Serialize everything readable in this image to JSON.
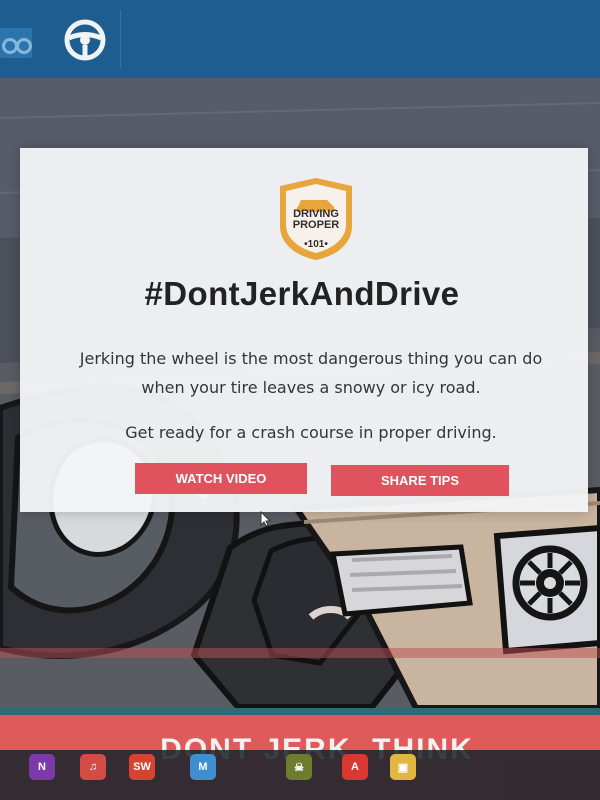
{
  "topbar": {
    "brand_icon": "car-driving-icon",
    "wheel_icon": "steering-wheel-icon"
  },
  "logo": {
    "text": "DRIVING PROPER",
    "number": "•101•"
  },
  "headline": "#DontJerkAndDrive",
  "body_text": "Jerking the wheel is the most dangerous thing you can do when your tire leaves a snowy or icy road.",
  "subtext": "Get ready for a crash course in proper driving.",
  "buttons": {
    "watch_video": "WATCH VIDEO",
    "share_tips": "SHARE TIPS"
  },
  "banner_text": "DONT JERK. THINK",
  "taskbar": [
    {
      "label": "N",
      "icon": "onenote-icon",
      "color": "#7b3aa8"
    },
    {
      "label": "♫",
      "icon": "music-icon",
      "color": "#d44b46"
    },
    {
      "label": "SW",
      "icon": "solidworks-icon",
      "color": "#d7432f"
    },
    {
      "label": "M",
      "icon": "app-icon",
      "color": "#3e8ed0"
    },
    {
      "label": "☠",
      "icon": "game-icon",
      "color": "#6d7c2d"
    },
    {
      "label": "A",
      "icon": "adobe-acrobat-icon",
      "color": "#d93830"
    },
    {
      "label": "▣",
      "icon": "folder-icon",
      "color": "#e1b740"
    }
  ]
}
